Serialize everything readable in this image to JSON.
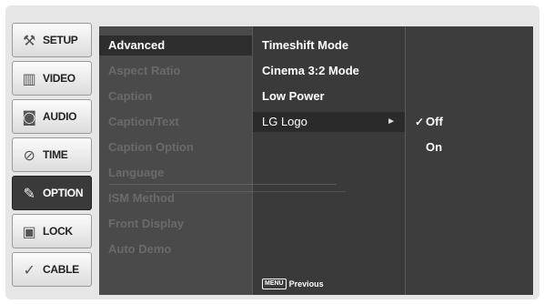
{
  "sidebar": {
    "items": [
      {
        "label": "SETUP",
        "icon": "wrench-icon"
      },
      {
        "label": "VIDEO",
        "icon": "film-icon"
      },
      {
        "label": "AUDIO",
        "icon": "speaker-icon"
      },
      {
        "label": "TIME",
        "icon": "clock-icon"
      },
      {
        "label": "OPTION",
        "icon": "pen-icon"
      },
      {
        "label": "LOCK",
        "icon": "padlock-icon"
      },
      {
        "label": "CABLE",
        "icon": "cable-icon"
      }
    ],
    "active": "OPTION"
  },
  "menu": {
    "column1": [
      "Advanced",
      "Aspect Ratio",
      "Caption",
      "Caption/Text",
      "Caption Option",
      "Language",
      "ISM Method",
      "Front Display",
      "Auto Demo"
    ],
    "column2": [
      "Timeshift Mode",
      "Cinema 3:2 Mode",
      "Low Power",
      "LG Logo"
    ],
    "column2_arrow": "►",
    "column3": [
      {
        "label": "Off",
        "checked": true
      },
      {
        "label": "On",
        "checked": false
      }
    ],
    "check_mark": "✓",
    "footer": {
      "key": "MENU",
      "label": "Previous"
    }
  },
  "colors": {
    "panel": "#3d3d3d",
    "highlight": "#2d2d2d",
    "disabled_text": "#6a6a6a",
    "active_tab": "#3a3a3a"
  }
}
